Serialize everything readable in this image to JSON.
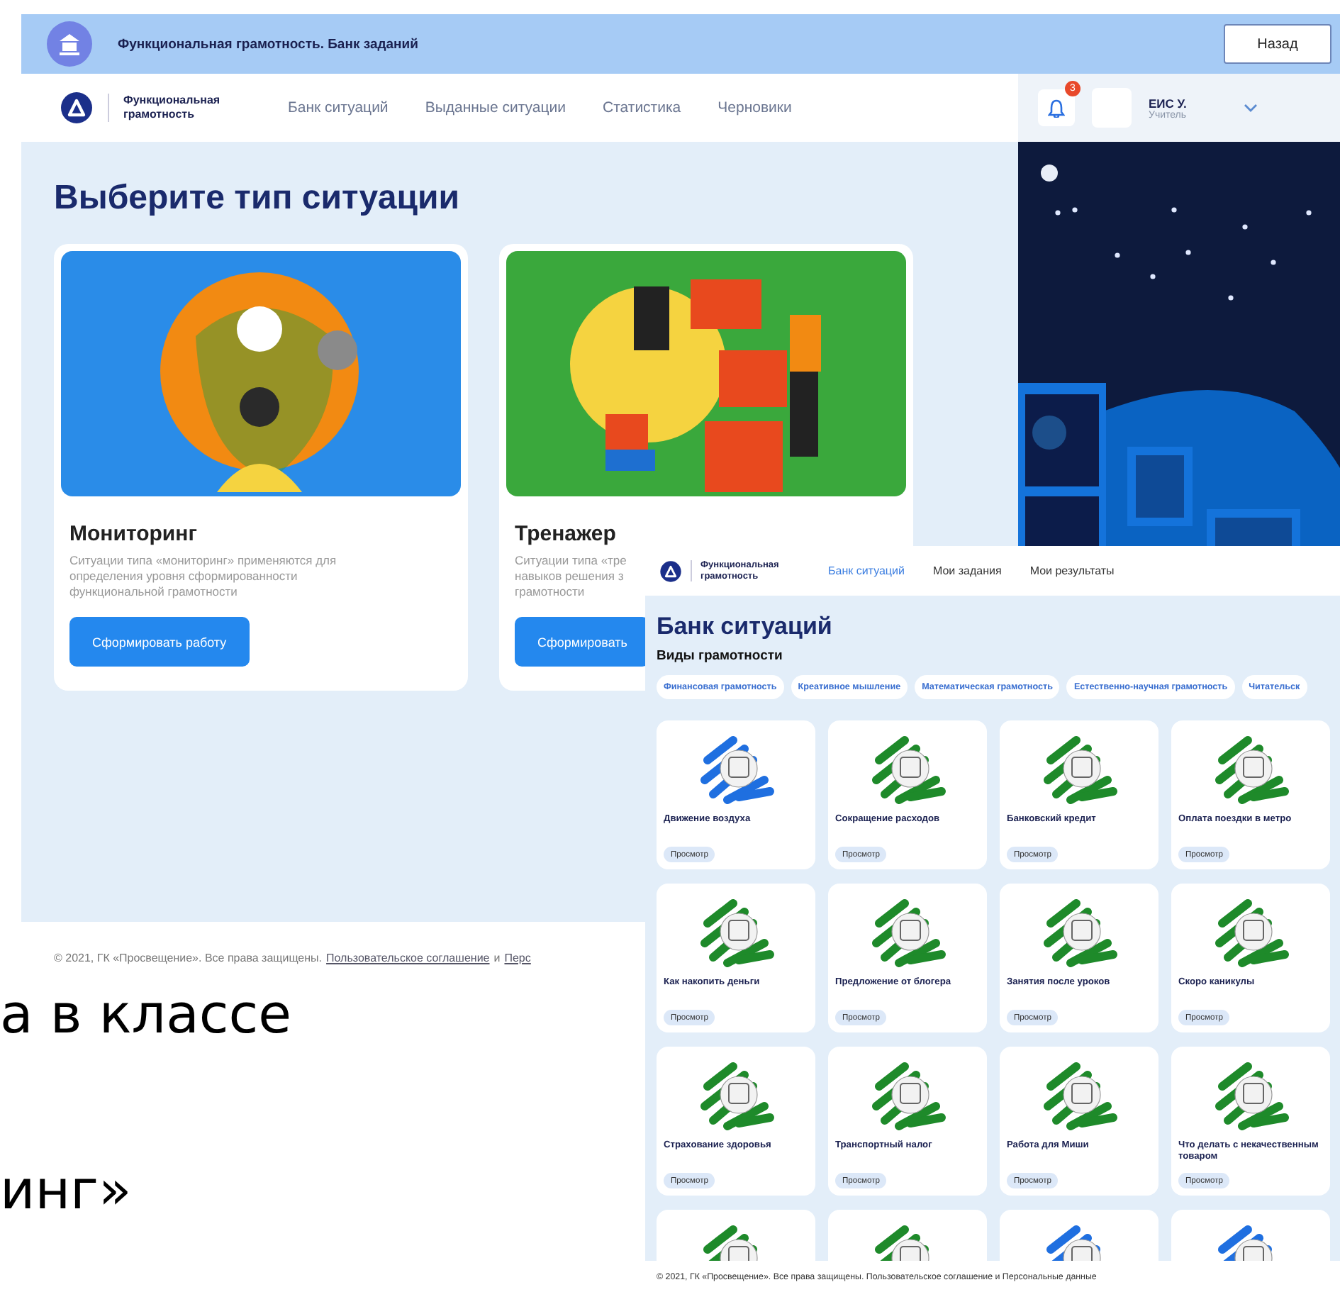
{
  "screen_a": {
    "header": {
      "title": "Функциональная грамотность. Банк заданий",
      "back_button": "Назад"
    },
    "nav": {
      "brand": "Функциональная грамотность",
      "links": [
        {
          "label": "Банк ситуаций",
          "selected": false
        },
        {
          "label": "Выданные ситуации",
          "selected": false
        },
        {
          "label": "Статистика",
          "selected": false
        },
        {
          "label": "Черновики",
          "selected": false
        }
      ],
      "notifications": "3",
      "user": {
        "name": "ЕИС У.",
        "role": "Учитель"
      }
    },
    "heading": "Выберите тип ситуации",
    "types": [
      {
        "title": "Мониторинг",
        "description": [
          "Ситуации типа «мониторинг» применяются для",
          "определения уровня сформированности",
          "функциональной грамотности"
        ],
        "button": "Сформировать работу",
        "color": "#2a8ce8"
      },
      {
        "title": "Тренажер",
        "description": [
          "Ситуации типа «тре",
          "навыков решения з",
          "грамотности"
        ],
        "button": "Сформировать",
        "color": "#3aa83c"
      }
    ],
    "footer": {
      "text": "© 2021, ГК «Просвещение». Все права защищены.",
      "links": [
        "Пользовательское соглашение",
        "Перс"
      ],
      "joiner": "и"
    }
  },
  "slide_text": [
    "а в классе",
    "инг»"
  ],
  "screen_b": {
    "nav": {
      "brand": "Функциональная грамотность",
      "links": [
        {
          "label": "Банк ситуаций",
          "selected": true
        },
        {
          "label": "Мои задания",
          "selected": false
        },
        {
          "label": "Мои результаты",
          "selected": false
        }
      ]
    },
    "heading": "Банк ситуаций",
    "subheading": "Виды грамотности",
    "chips": [
      "Финансовая грамотность",
      "Креативное мышление",
      "Математическая грамотность",
      "Естественно-научная грамотность",
      "Читательск"
    ],
    "cards": [
      {
        "title": "Движение воздуха",
        "button": "Просмотр",
        "color": "#1f6fe0"
      },
      {
        "title": "Сокращение расходов",
        "button": "Просмотр",
        "color": "#1e8a2a"
      },
      {
        "title": "Банковский кредит",
        "button": "Просмотр",
        "color": "#1e8a2a"
      },
      {
        "title": "Оплата поездки в метро",
        "button": "Просмотр",
        "color": "#1e8a2a"
      },
      {
        "title": "Как накопить деньги",
        "button": "Просмотр",
        "color": "#1e8a2a"
      },
      {
        "title": "Предложение от блогера",
        "button": "Просмотр",
        "color": "#1e8a2a"
      },
      {
        "title": "Занятия после уроков",
        "button": "Просмотр",
        "color": "#1e8a2a"
      },
      {
        "title": "Скоро каникулы",
        "button": "Просмотр",
        "color": "#1e8a2a"
      },
      {
        "title": "Страхование здоровья",
        "button": "Просмотр",
        "color": "#1e8a2a"
      },
      {
        "title": "Транспортный налог",
        "button": "Просмотр",
        "color": "#1e8a2a"
      },
      {
        "title": "Работа для Миши",
        "button": "Просмотр",
        "color": "#1e8a2a"
      },
      {
        "title": "Что делать с некачественным товаром",
        "button": "Просмотр",
        "color": "#1e8a2a"
      },
      {
        "color": "#1e8a2a"
      },
      {
        "color": "#1e8a2a"
      },
      {
        "color": "#1f6fe0"
      },
      {
        "color": "#1f6fe0"
      }
    ],
    "footer": "© 2021, ГК «Просвещение». Все права защищены. Пользовательское соглашение и Персональные данные"
  }
}
